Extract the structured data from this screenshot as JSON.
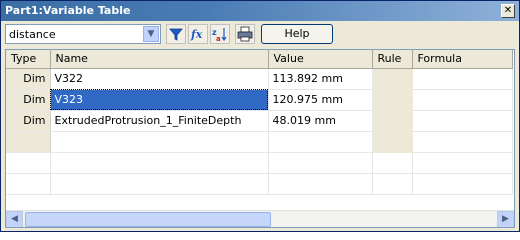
{
  "window": {
    "title": "Part1:Variable Table",
    "close_glyph": "✕"
  },
  "toolbar": {
    "filter_value": "distance",
    "help_label": "Help",
    "icons": [
      "filter-icon",
      "fx-formula-icon",
      "sort-icon",
      "print-icon"
    ]
  },
  "table": {
    "headers": [
      "Type",
      "Name",
      "Value",
      "Rule",
      "Formula"
    ],
    "rows": [
      {
        "type": "Dim",
        "name": "V322",
        "value": "113.892 mm",
        "rule": "",
        "formula": ""
      },
      {
        "type": "Dim",
        "name": "V323",
        "value": "120.975 mm",
        "rule": "",
        "formula": "",
        "selected": true
      },
      {
        "type": "Dim",
        "name": "ExtrudedProtrusion_1_FiniteDepth",
        "value": "48.019 mm",
        "rule": "",
        "formula": ""
      }
    ]
  },
  "colors": {
    "title_bar": "#3a6ea5",
    "selection": "#316ac5",
    "window_bg": "#ece9d8"
  }
}
